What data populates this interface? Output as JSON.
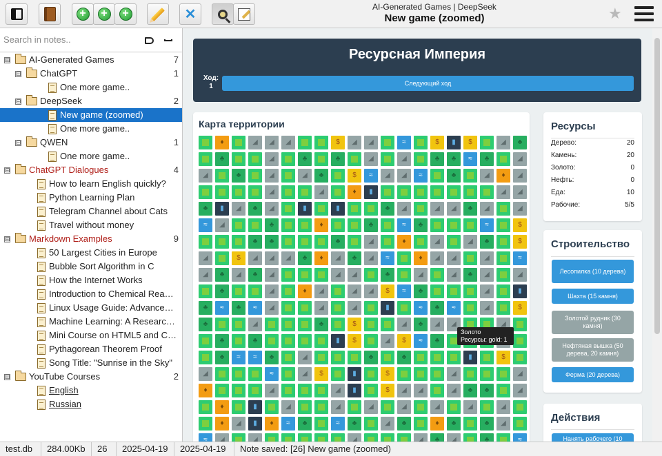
{
  "toolbar": {
    "breadcrumb": "AI-Generated Games  |  DeepSeek",
    "note_title": "New game (zoomed)",
    "buttons": [
      "toggle-sidebar",
      "notebook",
      "add-note",
      "add-subnote",
      "add-sibling",
      "edit",
      "delete",
      "search",
      "edit-mode"
    ]
  },
  "search": {
    "placeholder": "Search in notes.."
  },
  "tree": [
    {
      "label": "AI-Generated Games",
      "count": "7",
      "level": 0,
      "kind": "folder",
      "toggle": "⊟",
      "style": "normal"
    },
    {
      "label": "ChatGPT",
      "count": "1",
      "level": 1,
      "kind": "folder",
      "toggle": "⊟",
      "style": "normal"
    },
    {
      "label": "One more game..",
      "count": "",
      "level": 2,
      "kind": "doc",
      "toggle": "",
      "style": "normal"
    },
    {
      "label": "DeepSeek",
      "count": "2",
      "level": 1,
      "kind": "folder",
      "toggle": "⊟",
      "style": "normal"
    },
    {
      "label": "New game (zoomed)",
      "count": "",
      "level": 2,
      "kind": "doc",
      "toggle": "",
      "style": "selected"
    },
    {
      "label": "One more game..",
      "count": "",
      "level": 2,
      "kind": "doc",
      "toggle": "",
      "style": "normal"
    },
    {
      "label": "QWEN",
      "count": "1",
      "level": 1,
      "kind": "folder",
      "toggle": "⊟",
      "style": "normal"
    },
    {
      "label": "One more game..",
      "count": "",
      "level": 2,
      "kind": "doc",
      "toggle": "",
      "style": "normal"
    },
    {
      "label": "ChatGPT Dialogues",
      "count": "4",
      "level": 0,
      "kind": "folder",
      "toggle": "⊟",
      "style": "red"
    },
    {
      "label": "How to learn English quickly?",
      "count": "",
      "level": 1,
      "kind": "doc",
      "toggle": "",
      "style": "normal"
    },
    {
      "label": "Python Learning Plan",
      "count": "",
      "level": 1,
      "kind": "doc",
      "toggle": "",
      "style": "normal"
    },
    {
      "label": "Telegram Channel about Cats",
      "count": "",
      "level": 1,
      "kind": "doc",
      "toggle": "",
      "style": "normal"
    },
    {
      "label": "Travel without money",
      "count": "",
      "level": 1,
      "kind": "doc",
      "toggle": "",
      "style": "normal"
    },
    {
      "label": "Markdown Examples",
      "count": "9",
      "level": 0,
      "kind": "folder",
      "toggle": "⊟",
      "style": "red"
    },
    {
      "label": "50 Largest Cities in Europe",
      "count": "",
      "level": 1,
      "kind": "doc",
      "toggle": "",
      "style": "normal"
    },
    {
      "label": "Bubble Sort Algorithm in C",
      "count": "",
      "level": 1,
      "kind": "doc",
      "toggle": "",
      "style": "normal"
    },
    {
      "label": "How the Internet Works",
      "count": "",
      "level": 1,
      "kind": "doc",
      "toggle": "",
      "style": "normal"
    },
    {
      "label": "Introduction to Chemical Reacti...",
      "count": "",
      "level": 1,
      "kind": "doc",
      "toggle": "",
      "style": "normal"
    },
    {
      "label": "Linux Usage Guide: Advanced T...",
      "count": "",
      "level": 1,
      "kind": "doc",
      "toggle": "",
      "style": "normal"
    },
    {
      "label": "Machine Learning: A Research ...",
      "count": "",
      "level": 1,
      "kind": "doc",
      "toggle": "",
      "style": "normal"
    },
    {
      "label": "Mini Course on HTML5 and CSS3",
      "count": "",
      "level": 1,
      "kind": "doc",
      "toggle": "",
      "style": "normal"
    },
    {
      "label": "Pythagorean Theorem Proof",
      "count": "",
      "level": 1,
      "kind": "doc",
      "toggle": "",
      "style": "normal"
    },
    {
      "label": "Song Title: \"Sunrise in the Sky\"",
      "count": "",
      "level": 1,
      "kind": "doc",
      "toggle": "",
      "style": "normal"
    },
    {
      "label": "YouTube Courses",
      "count": "2",
      "level": 0,
      "kind": "folder",
      "toggle": "⊟",
      "style": "normal"
    },
    {
      "label": "English",
      "count": "",
      "level": 1,
      "kind": "doc",
      "toggle": "",
      "style": "link"
    },
    {
      "label": "Russian",
      "count": "",
      "level": 1,
      "kind": "doc",
      "toggle": "",
      "style": "link"
    }
  ],
  "status": {
    "db": "test.db",
    "size": "284.00Kb",
    "count": "26",
    "created": "2025-04-19",
    "modified": "2025-04-19",
    "message": "Note saved: [26] New game (zoomed)"
  },
  "game": {
    "title": "Ресурсная Империя",
    "turn_label": "Ход:",
    "turn_value": "1",
    "next_turn": "Следующий ход",
    "map_title": "Карта территории",
    "tile_legend": {
      "g": "grass",
      "f": "forest",
      "s": "stone",
      "o": "gold",
      "w": "water",
      "p": "oil",
      "m": "farm"
    },
    "tile_glyphs": {
      "f": "♣",
      "s": "◢",
      "o": "$",
      "w": "≈",
      "p": "▮",
      "m": "♦"
    },
    "map_rows": [
      "gmgsssggossgwgopogsf",
      "gfggsgfgfgsgsgffwfgs",
      "sgfgsgsfgowsswgfgsms",
      "ggggsggsgmpgggggggss",
      "fpsfsgpgpggfsgssfsgs",
      "wsggfggmggfgwfgggwgo",
      "gggffgggfgsgmgsgsfgo",
      "sgosssfmsfswgmssgsgw",
      "sfsfsgggssgfgsgsfsgs",
      "gfggsgmsgssowfgggsgpw",
      "fwfwsggsgsgpgwfwgsgo",
      "fggsgggfgoggsfssggsg",
      "gfgfggggpogsowfgggsg",
      "gfwwfgsgggfgfgggpgog",
      "sgggwgsogpgogggsgggs",
      "mgggsgggspgossgsffgs",
      "gmgpgsggsgsgsgsgsgsg",
      "gmspmwfgwfgsfgmfgfsg",
      "wsgsgggggsgggsfsgfgw"
    ],
    "tooltip_title": "Золото",
    "tooltip_text": "Ресурсы: gold: 1",
    "resources_title": "Ресурсы",
    "resources": [
      {
        "label": "Дерево:",
        "value": "20"
      },
      {
        "label": "Камень:",
        "value": "20"
      },
      {
        "label": "Золото:",
        "value": "0"
      },
      {
        "label": "Нефть:",
        "value": "0"
      },
      {
        "label": "Еда:",
        "value": "10"
      },
      {
        "label": "Рабочие:",
        "value": "5/5"
      }
    ],
    "build_title": "Строительство",
    "build_buttons": [
      {
        "label": "Лесопилка (10 дерева)",
        "enabled": true
      },
      {
        "label": "Шахта (15 камня)",
        "enabled": true
      },
      {
        "label": "Золотой рудник (30 камня)",
        "enabled": false
      },
      {
        "label": "Нефтяная вышка (50 дерева, 20 камня)",
        "enabled": false
      },
      {
        "label": "Ферма (20 дерева)",
        "enabled": true
      }
    ],
    "actions_title": "Действия",
    "action_buttons": [
      {
        "label": "Нанять рабочего (10"
      }
    ]
  }
}
